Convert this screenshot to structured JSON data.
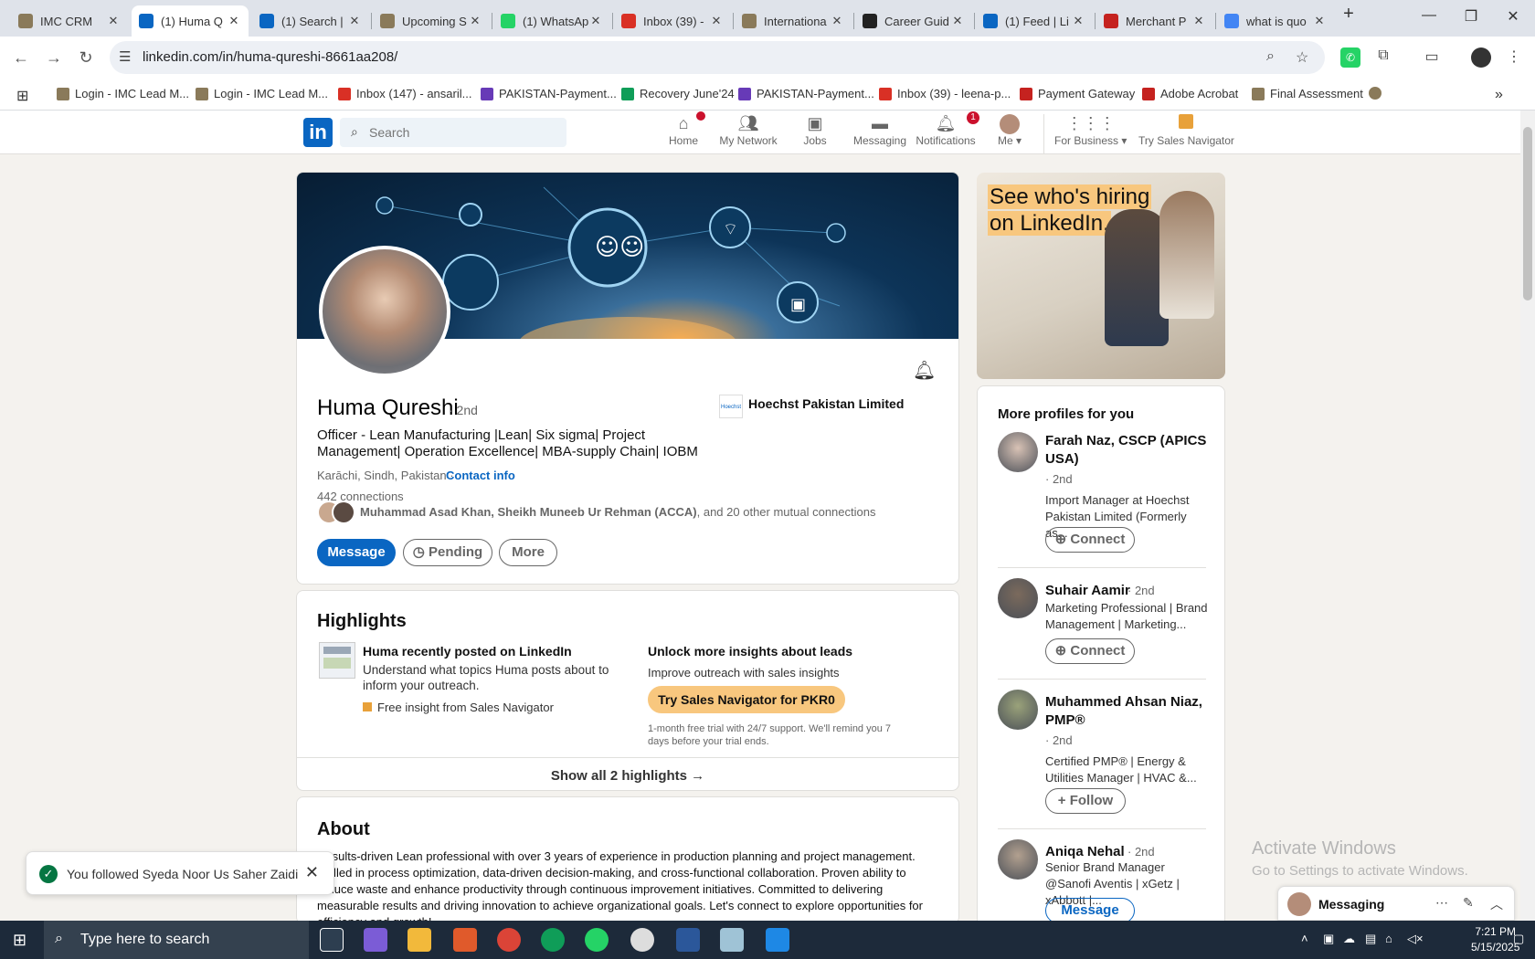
{
  "browser": {
    "tabs": [
      {
        "title": "IMC CRM",
        "fav": "#8a7a5a"
      },
      {
        "title": "(1) Huma Q",
        "fav": "#0a66c2",
        "active": true
      },
      {
        "title": "(1) Search |",
        "fav": "#0a66c2"
      },
      {
        "title": "Upcoming S",
        "fav": "#8a7a5a"
      },
      {
        "title": "(1) WhatsAp",
        "fav": "#25d366"
      },
      {
        "title": "Inbox (39) -",
        "fav": "#d93025"
      },
      {
        "title": "Internationa",
        "fav": "#8a7a5a"
      },
      {
        "title": "Career Guid",
        "fav": "#222222"
      },
      {
        "title": "(1) Feed | Li",
        "fav": "#0a66c2"
      },
      {
        "title": "Merchant P",
        "fav": "#c5221f"
      },
      {
        "title": "what is quo",
        "fav": "#4285f4"
      }
    ],
    "new_tab": "+",
    "url": "linkedin.com/in/huma-qureshi-8661aa208/",
    "bookmarks": [
      {
        "label": "Login - IMC Lead M...",
        "color": "#8a7a5a"
      },
      {
        "label": "Login - IMC Lead M...",
        "color": "#8a7a5a"
      },
      {
        "label": "Inbox (147) - ansaril...",
        "color": "#d93025"
      },
      {
        "label": "PAKISTAN-Payment...",
        "color": "#673ab7"
      },
      {
        "label": "Recovery June'24",
        "color": "#0f9d58"
      },
      {
        "label": "PAKISTAN-Payment...",
        "color": "#673ab7"
      },
      {
        "label": "Inbox (39) - leena-p...",
        "color": "#d93025"
      },
      {
        "label": "Payment Gateway",
        "color": "#c5221f"
      },
      {
        "label": "Adobe Acrobat",
        "color": "#c5221f"
      },
      {
        "label": "Final Assessment",
        "color": "#8a7a5a"
      }
    ]
  },
  "linkedin_nav": {
    "search_placeholder": "Search",
    "items": [
      {
        "label": "Home",
        "icon": "home-icon",
        "badge": ""
      },
      {
        "label": "My Network",
        "icon": "network-icon",
        "badge": ""
      },
      {
        "label": "Jobs",
        "icon": "jobs-icon",
        "badge": ""
      },
      {
        "label": "Messaging",
        "icon": "messaging-icon",
        "badge": ""
      },
      {
        "label": "Notifications",
        "icon": "bell-icon",
        "badge": "1"
      }
    ],
    "me": "Me",
    "for_business": "For Business",
    "sales_nav": "Try Sales Navigator"
  },
  "profile": {
    "name": "Huma Qureshi",
    "degree": "· 2nd",
    "headline": "Officer - Lean Manufacturing |Lean| Six sigma| Project Management| Operation Excellence| MBA-supply Chain| IOBM",
    "location": "Karāchi, Sindh, Pakistan ·",
    "contact": "Contact info",
    "connections": "442 connections",
    "mutual_names": "Muhammad Asad Khan, Sheikh Muneeb Ur Rehman (ACCA)",
    "mutual_rest": ", and 20 other mutual connections",
    "company": "Hoechst Pakistan Limited",
    "buttons": {
      "message": "Message",
      "pending": "Pending",
      "more": "More"
    }
  },
  "highlights": {
    "title": "Highlights",
    "left_title": "Huma recently posted on LinkedIn",
    "left_desc": "Understand what topics Huma posts about to inform your outreach.",
    "left_note": "Free insight from Sales Navigator",
    "right_title": "Unlock more insights about leads",
    "right_desc": "Improve outreach with sales insights",
    "right_btn": "Try Sales Navigator for PKR0",
    "right_fine": "1-month free trial with 24/7 support. We'll remind you 7 days before your trial ends.",
    "show_all": "Show all 2 highlights →"
  },
  "about": {
    "title": "About",
    "text": "Results-driven Lean professional with over 3 years of experience in production planning and project management. Skilled in process optimization, data-driven decision-making, and cross-functional collaboration. Proven ability to reduce waste and enhance productivity through continuous improvement initiatives. Committed to delivering measurable results and driving innovation to achieve organizational goals. Let's connect to explore opportunities for efficiency and growth!"
  },
  "ad": {
    "line1": "See who's hiring",
    "line2": "on LinkedIn."
  },
  "more_profiles": {
    "title": "More profiles for you",
    "people": [
      {
        "name": "Farah Naz, CSCP (APICS USA)",
        "degree": "· 2nd",
        "desc": "Import Manager at Hoechst Pakistan Limited (Formerly as...",
        "button": "Connect"
      },
      {
        "name": "Suhair Aamir",
        "degree": "· 2nd",
        "desc": "Marketing Professional | Brand Management | Marketing...",
        "button": "Connect"
      },
      {
        "name": "Muhammed Ahsan Niaz, PMP®",
        "degree": "· 2nd",
        "desc": "Certified PMP® | Energy & Utilities Manager | HVAC &...",
        "button": "Follow"
      },
      {
        "name": "Aniqa Nehal",
        "degree": "· 2nd",
        "desc": "Senior Brand Manager @Sanofi Aventis | xGetz | xAbbott |...",
        "button": "Message"
      }
    ]
  },
  "toast": "You followed Syeda Noor Us Saher Zaidi",
  "messaging": "Messaging",
  "watermark": {
    "title": "Activate Windows",
    "sub": "Go to Settings to activate Windows."
  },
  "taskbar": {
    "search_placeholder": "Type here to search",
    "time": "7:21 PM",
    "date": "5/15/2025"
  }
}
